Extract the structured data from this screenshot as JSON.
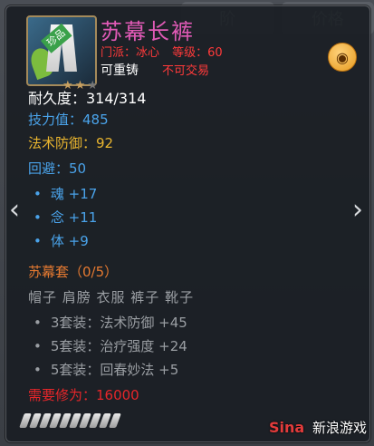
{
  "background": {
    "tabs": [
      "阶",
      "价格"
    ],
    "underlying_name": "苏幕长裤"
  },
  "item": {
    "badge": "珍品",
    "name": "苏幕长裤",
    "faction_label": "门派：冰心",
    "level_label": "等级：60",
    "recast": "可重铸",
    "untradable": "不可交易",
    "stars": {
      "filled": 2,
      "total": 3
    }
  },
  "stats": {
    "durability": "耐久度：314/314",
    "skill": "技力值：485",
    "magic_defense": "法术防御：92",
    "dodge": "回避：50",
    "subs": [
      "魂 +17",
      "念 +11",
      "体 +9"
    ]
  },
  "set": {
    "title": "苏幕套（0/5）",
    "pieces": "帽子 肩膀 衣服 裤子 靴子",
    "bonuses": [
      "3套装：法术防御 +45",
      "5套装：治疗强度 +24",
      "5套装：回春妙法 +5"
    ],
    "requirement": "需要修为：16000"
  },
  "nav": {
    "prev": "‹",
    "next": "›"
  },
  "bottom": {
    "pip_count": 10
  },
  "watermark": {
    "logo": "Sina",
    "text": "新浪游戏"
  },
  "colors": {
    "name": "#e05ab6",
    "red": "#ff3a3a",
    "blue": "#4aa3ea",
    "yellow": "#e9b52f",
    "orange": "#e67a31",
    "gray": "#9a9ea3"
  }
}
